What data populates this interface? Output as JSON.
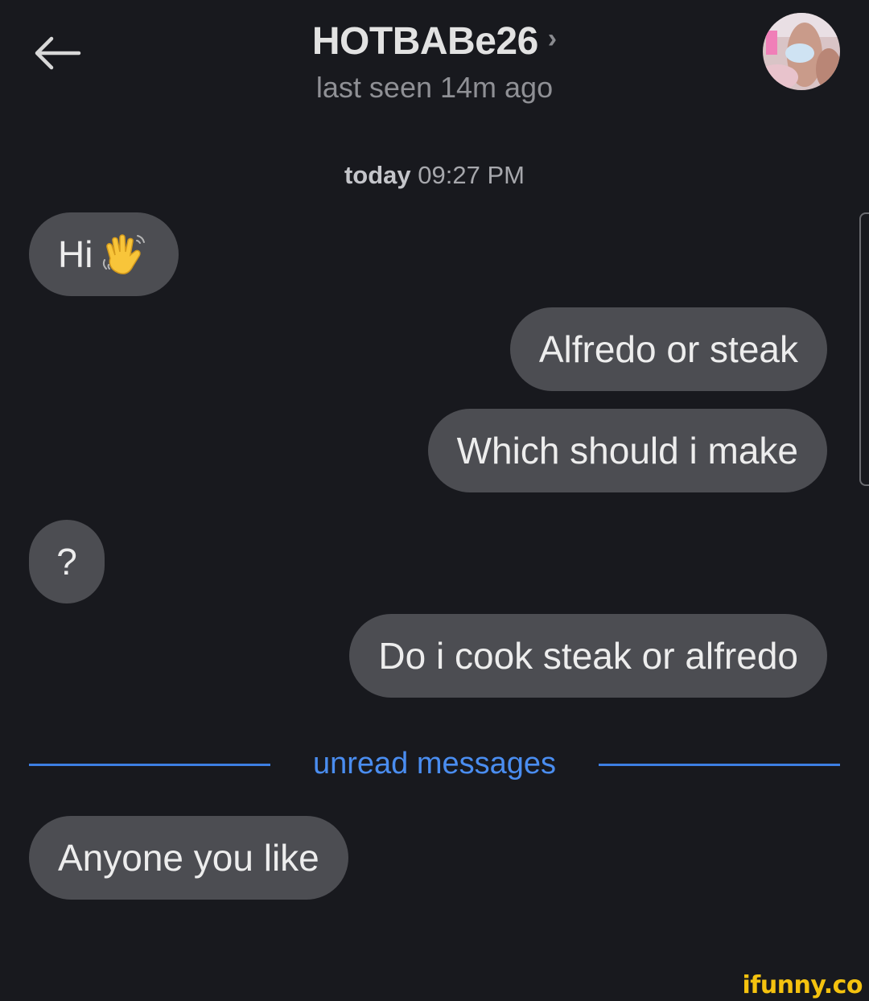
{
  "header": {
    "title": "HOTBABe26",
    "chevron": "›",
    "subtitle": "last seen 14m ago",
    "back_icon": "arrow-left-icon",
    "avatar": "contact-avatar"
  },
  "chat": {
    "date_separator": {
      "day": "today",
      "time": "09:27 PM"
    },
    "messages": [
      {
        "side": "left",
        "text": "Hi",
        "emoji": "waving-hand"
      },
      {
        "side": "right",
        "text": "Alfredo or steak"
      },
      {
        "side": "right",
        "text": "Which should i make"
      },
      {
        "side": "left",
        "text": "?"
      },
      {
        "side": "right",
        "text": "Do i cook steak or alfredo"
      },
      {
        "side": "left",
        "text": "Anyone you like"
      }
    ],
    "unread_label": "unread messages"
  },
  "watermark": "ifunny.co",
  "colors": {
    "background": "#18191e",
    "bubble": "#4c4d52",
    "accent": "#3d7fe3",
    "watermark": "#f4c20f"
  }
}
